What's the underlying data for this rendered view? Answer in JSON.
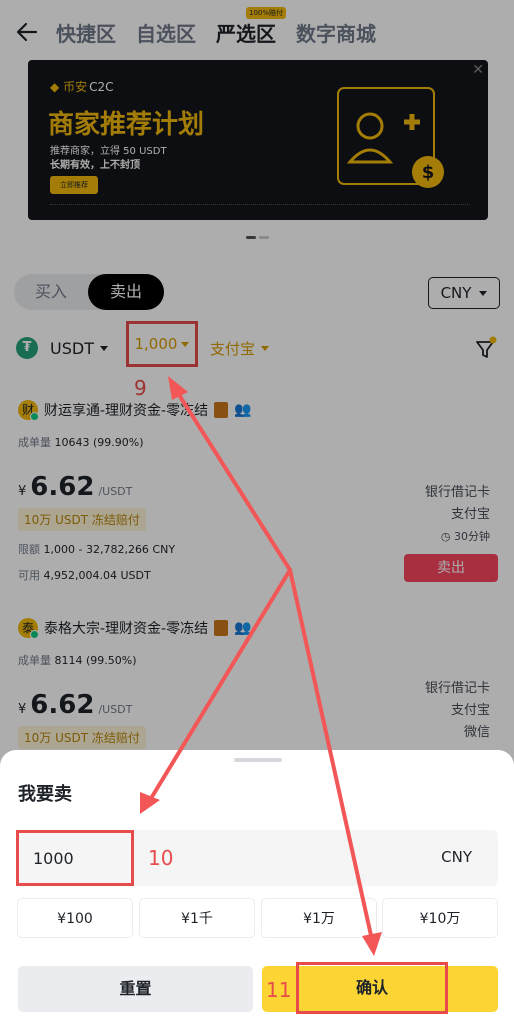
{
  "nav": {
    "tabs": [
      "快捷区",
      "自选区",
      "严选区",
      "数字商城"
    ],
    "badge": "100%赔付"
  },
  "banner": {
    "brand": "币安",
    "brand_suffix": "C2C",
    "headline": "商家推荐计划",
    "sub1": "推荐商家，立得 50 USDT",
    "sub2": "长期有效，上不封顶",
    "cta": "立即推荐"
  },
  "toggle": {
    "buy": "买入",
    "sell": "卖出"
  },
  "currency": "CNY",
  "filters": {
    "asset": "USDT",
    "amount": "1,000",
    "payment": "支付宝"
  },
  "steps": {
    "s9": "9",
    "s10": "10",
    "s11": "11"
  },
  "ads": [
    {
      "avatar": "财",
      "name": "财运享通-理财资金-零冻结",
      "stats_label": "成单量",
      "stats": "10643 (99.90%)",
      "currency_symbol": "¥",
      "price": "6.62",
      "unit": "/USDT",
      "tag": "10万 USDT 冻结赔付",
      "limit_label": "限额",
      "limit": "1,000 - 32,782,266 CNY",
      "available_label": "可用",
      "available": "4,952,004.04 USDT",
      "pay1": "银行借记卡",
      "pay2": "支付宝",
      "time": "30分钟",
      "button": "卖出"
    },
    {
      "avatar": "泰",
      "name": "泰格大宗-理财资金-零冻结",
      "stats_label": "成单量",
      "stats": "8114 (99.50%)",
      "currency_symbol": "¥",
      "price": "6.62",
      "unit": "/USDT",
      "tag": "10万 USDT 冻结赔付",
      "pay1": "银行借记卡",
      "pay2": "支付宝",
      "pay3": "微信"
    }
  ],
  "sheet": {
    "title": "我要卖",
    "amount_value": "1000",
    "amount_currency": "CNY",
    "quick": [
      "¥100",
      "¥1千",
      "¥1万",
      "¥10万"
    ],
    "reset": "重置",
    "confirm": "确认"
  }
}
